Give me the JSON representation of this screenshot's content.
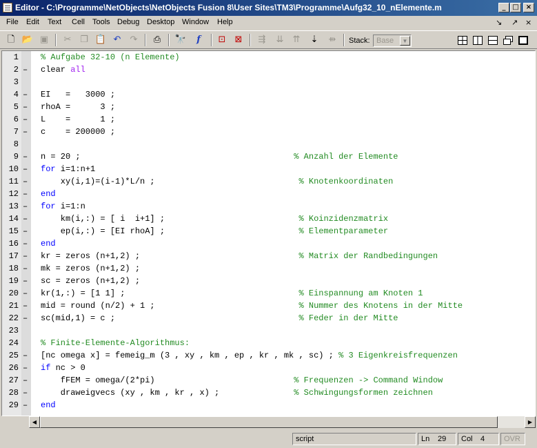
{
  "window": {
    "title": "Editor - C:\\Programme\\NetObjects\\NetObjects Fusion 8\\User Sites\\TM3\\Programme\\Aufg32_10_nElemente.m",
    "minimize": "_",
    "maximize": "□",
    "close": "×"
  },
  "menu": {
    "items": [
      "File",
      "Edit",
      "Text",
      "Cell",
      "Tools",
      "Debug",
      "Desktop",
      "Window",
      "Help"
    ],
    "dock_icon": "↘",
    "undock_icon": "↗",
    "close_icon": "×"
  },
  "toolbar": {
    "stack_label": "Stack:",
    "stack_value": "Base",
    "icons": [
      "new-file-icon",
      "open-folder-icon",
      "save-icon",
      "cut-icon",
      "copy-icon",
      "paste-icon",
      "undo-icon",
      "redo-icon",
      "print-icon",
      "find-icon",
      "function-icon",
      "set-breakpoint-icon",
      "clear-breakpoints-icon",
      "step-icon",
      "step-in-icon",
      "step-out-icon",
      "continue-icon",
      "exit-debug-icon"
    ]
  },
  "editor": {
    "lines": [
      {
        "n": "1",
        "dash": "",
        "parts": [
          {
            "t": "% Aufgabe 32-10 (n Elemente)",
            "c": "cm"
          }
        ]
      },
      {
        "n": "2",
        "dash": "–",
        "parts": [
          {
            "t": "clear ",
            "c": ""
          },
          {
            "t": "all",
            "c": "str"
          }
        ]
      },
      {
        "n": "3",
        "dash": "",
        "parts": []
      },
      {
        "n": "4",
        "dash": "–",
        "parts": [
          {
            "t": "EI   =   3000 ;",
            "c": ""
          }
        ]
      },
      {
        "n": "5",
        "dash": "–",
        "parts": [
          {
            "t": "rhoA =      3 ;",
            "c": ""
          }
        ]
      },
      {
        "n": "6",
        "dash": "–",
        "parts": [
          {
            "t": "L    =      1 ;",
            "c": ""
          }
        ]
      },
      {
        "n": "7",
        "dash": "–",
        "parts": [
          {
            "t": "c    = 200000 ;",
            "c": ""
          }
        ]
      },
      {
        "n": "8",
        "dash": "",
        "parts": []
      },
      {
        "n": "9",
        "dash": "–",
        "parts": [
          {
            "t": "n = 20 ;                                           ",
            "c": ""
          },
          {
            "t": "% Anzahl der Elemente",
            "c": "cm"
          }
        ]
      },
      {
        "n": "10",
        "dash": "–",
        "parts": [
          {
            "t": "for",
            "c": "kw"
          },
          {
            "t": " i=1:n+1",
            "c": ""
          }
        ]
      },
      {
        "n": "11",
        "dash": "–",
        "parts": [
          {
            "t": "    xy(i,1)=(i-1)*L/n ;                             ",
            "c": ""
          },
          {
            "t": "% Knotenkoordinaten",
            "c": "cm"
          }
        ]
      },
      {
        "n": "12",
        "dash": "–",
        "parts": [
          {
            "t": "end",
            "c": "kw"
          }
        ]
      },
      {
        "n": "13",
        "dash": "–",
        "parts": [
          {
            "t": "for",
            "c": "kw"
          },
          {
            "t": " i=1:n",
            "c": ""
          }
        ]
      },
      {
        "n": "14",
        "dash": "–",
        "parts": [
          {
            "t": "    km(i,:) = [ i  i+1] ;                           ",
            "c": ""
          },
          {
            "t": "% Koinzidenzmatrix",
            "c": "cm"
          }
        ]
      },
      {
        "n": "15",
        "dash": "–",
        "parts": [
          {
            "t": "    ep(i,:) = [EI rhoA] ;                           ",
            "c": ""
          },
          {
            "t": "% Elementparameter",
            "c": "cm"
          }
        ]
      },
      {
        "n": "16",
        "dash": "–",
        "parts": [
          {
            "t": "end",
            "c": "kw"
          }
        ]
      },
      {
        "n": "17",
        "dash": "–",
        "parts": [
          {
            "t": "kr = zeros (n+1,2) ;                                ",
            "c": ""
          },
          {
            "t": "% Matrix der Randbedingungen",
            "c": "cm"
          }
        ]
      },
      {
        "n": "18",
        "dash": "–",
        "parts": [
          {
            "t": "mk = zeros (n+1,2) ;",
            "c": ""
          }
        ]
      },
      {
        "n": "19",
        "dash": "–",
        "parts": [
          {
            "t": "sc = zeros (n+1,2) ;",
            "c": ""
          }
        ]
      },
      {
        "n": "20",
        "dash": "–",
        "parts": [
          {
            "t": "kr(1,:) = [1 1] ;                                   ",
            "c": ""
          },
          {
            "t": "% Einspannung am Knoten 1",
            "c": "cm"
          }
        ]
      },
      {
        "n": "21",
        "dash": "–",
        "parts": [
          {
            "t": "mid = round (n/2) + 1 ;                             ",
            "c": ""
          },
          {
            "t": "% Nummer des Knotens in der Mitte",
            "c": "cm"
          }
        ]
      },
      {
        "n": "22",
        "dash": "–",
        "parts": [
          {
            "t": "sc(mid,1) = c ;                                     ",
            "c": ""
          },
          {
            "t": "% Feder in der Mitte",
            "c": "cm"
          }
        ]
      },
      {
        "n": "23",
        "dash": "",
        "parts": []
      },
      {
        "n": "24",
        "dash": "",
        "parts": [
          {
            "t": "% Finite-Elemente-Algorithmus:",
            "c": "cm"
          }
        ]
      },
      {
        "n": "25",
        "dash": "–",
        "parts": [
          {
            "t": "[nc omega x] = femeig_m (3 , xy , km , ep , kr , mk , sc) ; ",
            "c": ""
          },
          {
            "t": "% 3 Eigenkreisfrequenzen",
            "c": "cm"
          }
        ]
      },
      {
        "n": "26",
        "dash": "–",
        "parts": [
          {
            "t": "if",
            "c": "kw"
          },
          {
            "t": " nc > 0",
            "c": ""
          }
        ]
      },
      {
        "n": "27",
        "dash": "–",
        "parts": [
          {
            "t": "    fFEM = omega/(2*pi)                            ",
            "c": ""
          },
          {
            "t": "% Frequenzen -> Command Window",
            "c": "cm"
          }
        ]
      },
      {
        "n": "28",
        "dash": "–",
        "parts": [
          {
            "t": "    draweigvecs (xy , km , kr , x) ;               ",
            "c": ""
          },
          {
            "t": "% Schwingungsformen zeichnen",
            "c": "cm"
          }
        ]
      },
      {
        "n": "29",
        "dash": "–",
        "parts": [
          {
            "t": "end",
            "c": "kw"
          }
        ]
      }
    ]
  },
  "status": {
    "mode": "script",
    "ln_label": "Ln",
    "ln_value": "29",
    "col_label": "Col",
    "col_value": "4",
    "ovr": "OVR"
  }
}
